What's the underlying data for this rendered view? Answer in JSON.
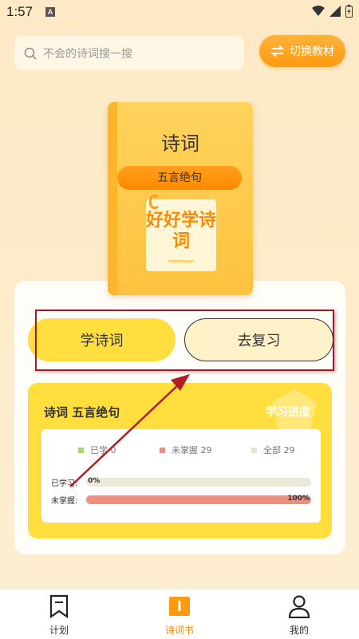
{
  "status_bar": {
    "time": "1:57",
    "notification_icon": "A"
  },
  "search": {
    "placeholder": "不会的诗词搜一搜"
  },
  "switch_textbook": {
    "label": "切换教材"
  },
  "book": {
    "title": "诗词",
    "subtitle": "五言绝句",
    "note_text": "好好学诗词"
  },
  "actions": {
    "learn_label": "学诗词",
    "review_label": "去复习"
  },
  "progress": {
    "title": "诗词 五言绝句",
    "badge": "学习进度",
    "legend": [
      {
        "label": "已学 0",
        "color": "#a8d86c"
      },
      {
        "label": "未掌握 29",
        "color": "#ef8f7e"
      },
      {
        "label": "全部 29",
        "color": "#e8e6d2"
      }
    ],
    "bars": [
      {
        "label": "已学习:",
        "value_text": "0%",
        "fraction": 0.0
      },
      {
        "label": "未掌握:",
        "value_text": "100%",
        "fraction": 1.0
      }
    ]
  },
  "colors": {
    "accent": "#ff9a10",
    "card_yellow": "#ffde3d",
    "annotation": "#a31b20"
  },
  "bottom_nav": [
    {
      "label": "计划",
      "icon": "bookmark-icon",
      "active": false
    },
    {
      "label": "诗词书",
      "icon": "book-icon",
      "active": true
    },
    {
      "label": "我的",
      "icon": "user-icon",
      "active": false
    }
  ]
}
